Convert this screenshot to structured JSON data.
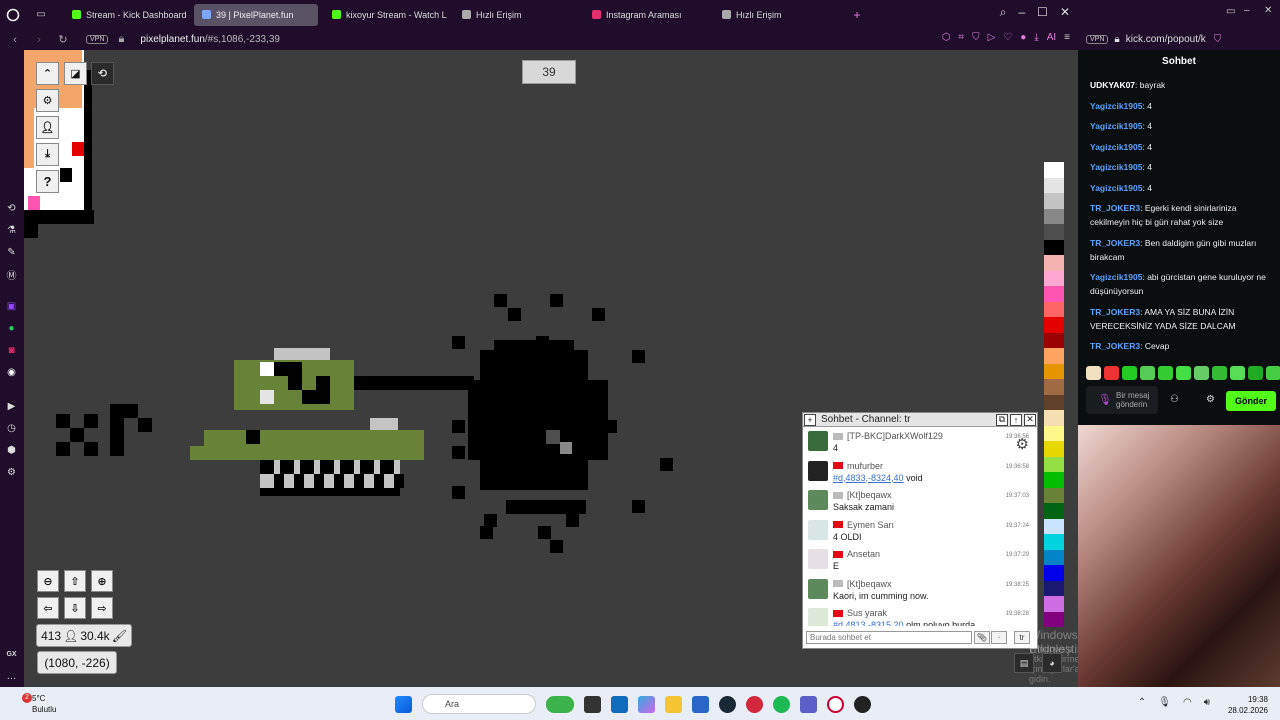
{
  "browser": {
    "tabs": [
      {
        "label": "Stream - Kick Dashboard",
        "color": "#53fc18",
        "active": false
      },
      {
        "label": "39 | PixelPlanet.fun",
        "color": "#7aa7ff",
        "active": true
      },
      {
        "label": "kixoyur Stream - Watch L",
        "color": "#53fc18",
        "active": false
      },
      {
        "label": "Hızlı Erişim",
        "color": "#aaaaaa",
        "active": false
      },
      {
        "label": "Instagram Araması",
        "color": "#e1306c",
        "active": false
      },
      {
        "label": "Hızlı Erişim",
        "color": "#aaaaaa",
        "active": false
      }
    ],
    "vpn_label": "VPN",
    "url_host": "pixelplanet.fun",
    "url_path": "/#s,1086,-233,39",
    "ai_label": "AI"
  },
  "pixelplanet": {
    "online_count": "39",
    "pixel_count": "413",
    "online_users": "30.4k",
    "coords": "(1080, -226)",
    "palette": [
      "#ffffff",
      "#e4e4e4",
      "#c4c4c4",
      "#888888",
      "#4e4e4e",
      "#000000",
      "#f4b3ae",
      "#ffa7d1",
      "#ff54b2",
      "#ff6565",
      "#e50000",
      "#9a0000",
      "#fea460",
      "#e59500",
      "#a06a42",
      "#604028",
      "#f5dfb0",
      "#fff889",
      "#e5d900",
      "#94e044",
      "#02be01",
      "#688338",
      "#006513",
      "#cae3ff",
      "#00d3dd",
      "#0083c7",
      "#0000ea",
      "#191973",
      "#cf6ee4",
      "#820080"
    ]
  },
  "ingame_chat": {
    "title": "Sohbet - Channel: tr",
    "input_placeholder": "Burada sohbet et",
    "lang_btn": "tr",
    "messages": [
      {
        "name": "[TP-BKC]DarkXWolf129",
        "time": "19:36:56",
        "text": "4",
        "link": "",
        "avatar": "#3a6b3a",
        "flag": "gray"
      },
      {
        "name": "mufurber",
        "time": "19:36:58",
        "text": " void",
        "link": "#d,4833,-8324,40",
        "avatar": "#222222",
        "flag": "red"
      },
      {
        "name": "[Kt]beqawx",
        "time": "19:37:03",
        "text": "Saksak zamani",
        "link": "",
        "avatar": "#5d8a5a",
        "flag": "gray"
      },
      {
        "name": "Eymen Sarı",
        "time": "19:37:24",
        "text": "4 OLDI",
        "link": "",
        "avatar": "#d8e6e6",
        "flag": "red"
      },
      {
        "name": "Ansetan",
        "time": "19:37:29",
        "text": "E",
        "link": "",
        "avatar": "#e6dfe6",
        "flag": "red"
      },
      {
        "name": "[Kt]beqawx",
        "time": "19:38:25",
        "text": "Kaori, im cumming now.",
        "link": "",
        "avatar": "#5d8a5a",
        "flag": "gray"
      },
      {
        "name": "Sus yarak",
        "time": "19:38:28",
        "text": " olm noluyo burda",
        "link": "#d,4813,-8315,20",
        "avatar": "#dbe9d6",
        "flag": "red"
      }
    ]
  },
  "watermark": {
    "line1": "Windows'u Etkinleştir",
    "line2": "Windows'u etkinleştirmek için Ayarlar'a gidin."
  },
  "kick": {
    "url": "kick.com/popout/k",
    "title": "Sohbet",
    "messages": [
      {
        "user": "UDKYAK07",
        "color": "#ffffff",
        "text": "bayrak"
      },
      {
        "user": "Yagizcik1905",
        "color": "#5ba2ff",
        "text": "4"
      },
      {
        "user": "Yagizcik1905",
        "color": "#5ba2ff",
        "text": "4"
      },
      {
        "user": "Yagizcik1905",
        "color": "#5ba2ff",
        "text": "4"
      },
      {
        "user": "Yagizcik1905",
        "color": "#5ba2ff",
        "text": "4"
      },
      {
        "user": "Yagizcik1905",
        "color": "#5ba2ff",
        "text": "4"
      },
      {
        "user": "TR_JOKER3",
        "color": "#5ba2ff",
        "text": "Egerki kendi sinirlariniza cekilmeyin hiç bi gün rahat yok size"
      },
      {
        "user": "TR_JOKER3",
        "color": "#5ba2ff",
        "text": "Ben daldigim gün gibi muzları birakcam"
      },
      {
        "user": "Yagizcik1905",
        "color": "#5ba2ff",
        "text": "abi gürcistan gene kuruluyor ne düşünüyorsun"
      },
      {
        "user": "TR_JOKER3",
        "color": "#5ba2ff",
        "text": "AMA YA SİZ BUNA İZİN VERECEKSİNİZ YADA SİZE DALCAM"
      },
      {
        "user": "TR_JOKER3",
        "color": "#5ba2ff",
        "text": "Cevap"
      }
    ],
    "input_placeholder": "Bir mesaj gönderin",
    "send_label": "Gönder"
  },
  "taskbar": {
    "temp": "5°C",
    "weather": "Bulutlu",
    "search": "Ara",
    "time": "19:38",
    "date": "28.02.2026",
    "notif_count": "2"
  }
}
